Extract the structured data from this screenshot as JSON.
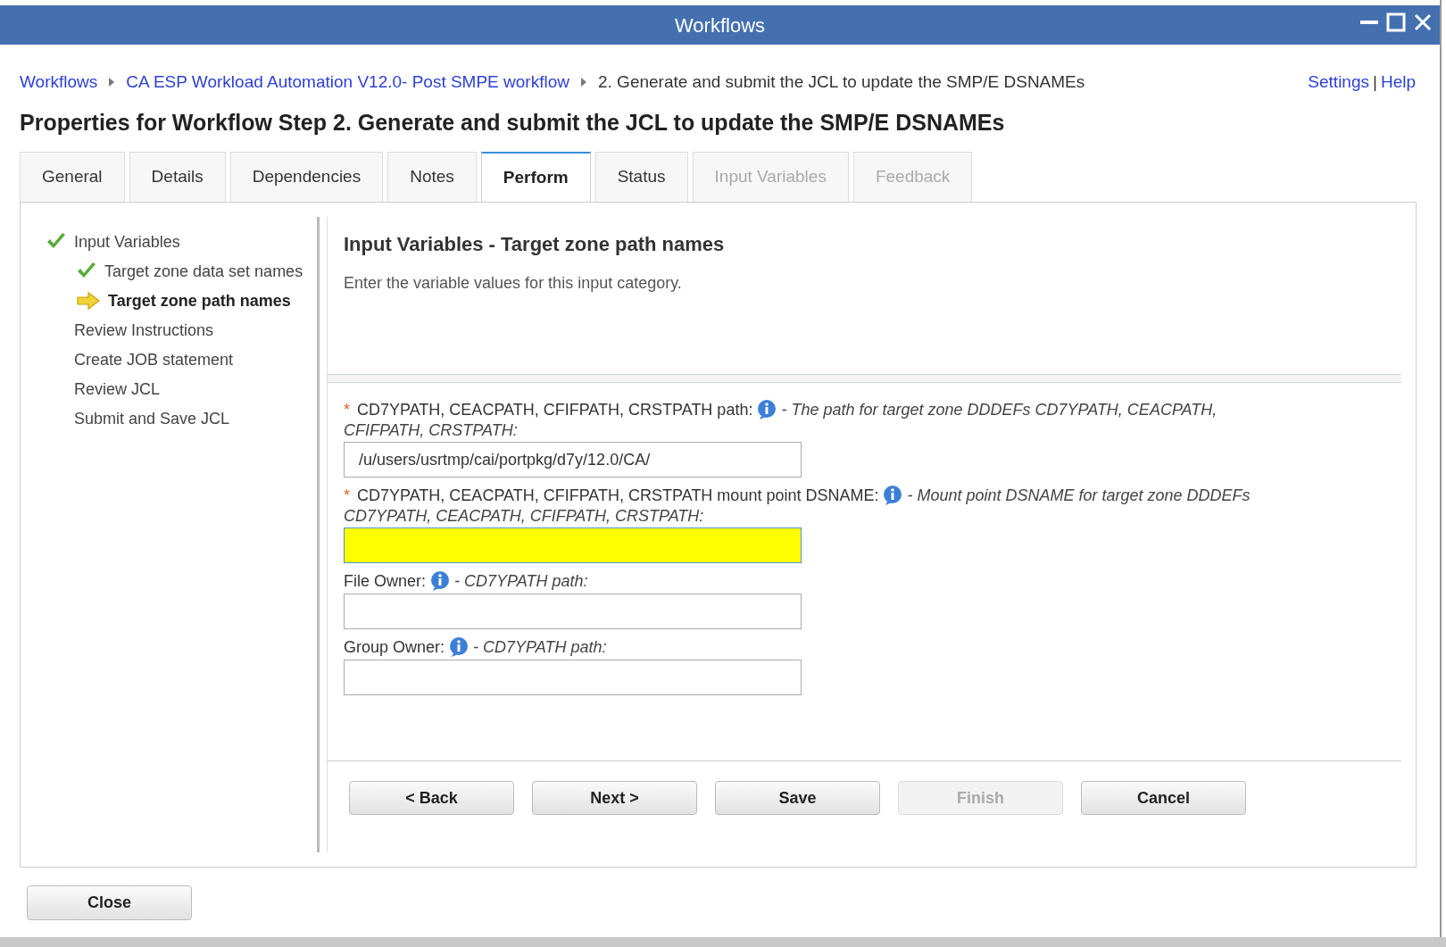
{
  "window": {
    "title": "Workflows"
  },
  "breadcrumb": [
    {
      "label": "Workflows",
      "kind": "link"
    },
    {
      "label": "CA ESP Workload Automation V12.0- Post SMPE workflow",
      "kind": "link"
    },
    {
      "label": "2. Generate and submit the JCL to update the SMP/E DSNAMEs",
      "kind": "text"
    }
  ],
  "top_links": [
    "Settings",
    "|",
    "Help"
  ],
  "heading": "Properties for Workflow Step 2. Generate and submit the JCL to update the SMP/E DSNAMEs",
  "tabs": [
    {
      "label": "General",
      "selected": false,
      "disabled": false
    },
    {
      "label": "Details",
      "selected": false,
      "disabled": false
    },
    {
      "label": "Dependencies",
      "selected": false,
      "disabled": false
    },
    {
      "label": "Notes",
      "selected": false,
      "disabled": false
    },
    {
      "label": "Perform",
      "selected": true,
      "disabled": false
    },
    {
      "label": "Status",
      "selected": false,
      "disabled": false
    },
    {
      "label": "Input Variables",
      "selected": false,
      "disabled": true
    },
    {
      "label": "Feedback",
      "selected": false,
      "disabled": true
    }
  ],
  "steps": [
    {
      "label": "Input Variables",
      "kind": "done",
      "children": [
        {
          "label": "Target zone data set names",
          "kind": "done"
        },
        {
          "label": "Target zone path names",
          "kind": "current"
        }
      ]
    },
    {
      "label": "Review Instructions",
      "kind": "pending"
    },
    {
      "label": "Create JOB statement",
      "kind": "pending"
    },
    {
      "label": "Review JCL",
      "kind": "pending"
    },
    {
      "label": "Submit and Save JCL",
      "kind": "pending"
    }
  ],
  "panel": {
    "title": "Input Variables - Target zone path names",
    "instructions": "Enter the variable values for this input category."
  },
  "fields": [
    {
      "required_mark": "*",
      "label": "CD7YPATH, CEACPATH, CFIFPATH, CRSTPATH path:",
      "description_lines": [
        "- The path for target zone DDDEFs CD7YPATH, CEACPATH,",
        "CFIFPATH, CRSTPATH:"
      ],
      "value": "/u/users/usrtmp/cai/portpkg/d7y/12.0/CA/",
      "highlighted": false
    },
    {
      "required_mark": "*",
      "label": "CD7YPATH, CEACPATH, CFIFPATH, CRSTPATH mount point DSNAME:",
      "description_lines": [
        "- Mount point DSNAME for target zone DDDEFs",
        "CD7YPATH, CEACPATH, CFIFPATH, CRSTPATH:"
      ],
      "highlighted": true
    },
    {
      "label": "File Owner:",
      "description_lines": [
        "- CD7YPATH path:"
      ],
      "highlighted": false
    },
    {
      "label": "Group Owner:",
      "description_lines": [
        "- CD7YPATH path:"
      ],
      "highlighted": false
    }
  ],
  "buttons": [
    {
      "label": "< Back",
      "disabled": false
    },
    {
      "label": "Next >",
      "disabled": false
    },
    {
      "label": "Save",
      "disabled": false
    },
    {
      "label": "Finish",
      "disabled": true
    },
    {
      "label": "Cancel",
      "disabled": false
    }
  ],
  "close_button": "Close"
}
